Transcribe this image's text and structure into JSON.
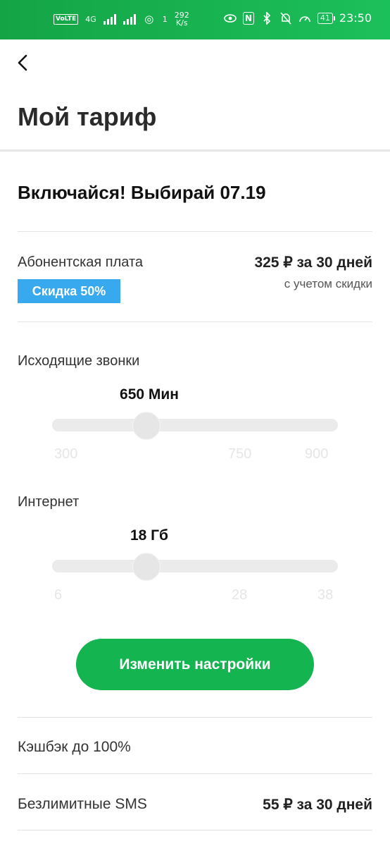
{
  "status_bar": {
    "volte": "VoLTE",
    "network": "4G",
    "sim": "1",
    "net_speed_value": "292",
    "net_speed_unit": "K/s",
    "nfc": "N",
    "battery": "41",
    "time": "23:50"
  },
  "header": {
    "title": "Мой тариф"
  },
  "plan": {
    "name": "Включайся! Выбирай 07.19"
  },
  "fee": {
    "label": "Абонентская плата",
    "value": "325 ₽ за 30 дней",
    "note": "с учетом скидки",
    "badge": "Скидка 50%"
  },
  "calls": {
    "label": "Исходящие звонки",
    "value": "650 Мин",
    "current": 650,
    "ticks": [
      "300",
      "750",
      "900"
    ]
  },
  "internet": {
    "label": "Интернет",
    "value": "18 Гб",
    "current": 18,
    "ticks": [
      "6",
      "28",
      "38"
    ]
  },
  "button": {
    "label": "Изменить настройки"
  },
  "rows": [
    {
      "label": "Кэшбэк до 100%",
      "value": ""
    },
    {
      "label": "Безлимитные SMS",
      "value": "55 ₽ за 30 дней"
    }
  ],
  "colors": {
    "accent": "#14b451",
    "badge": "#38a9ee",
    "status_bar": "#1cc05a"
  }
}
